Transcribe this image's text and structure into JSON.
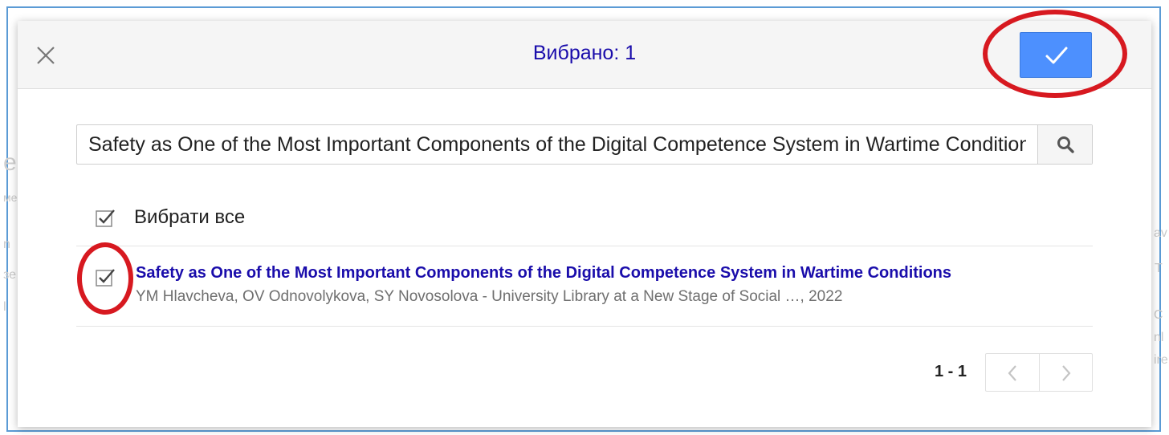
{
  "background_fragments": [
    "е",
    "ме",
    "n",
    "зе",
    "l",
    "av",
    "T",
    "С",
    "nl",
    "ire"
  ],
  "dialog": {
    "title": "Вибрано: 1",
    "close_icon": "close-icon",
    "confirm_icon": "checkmark-icon"
  },
  "search": {
    "value": "Safety as One of the Most Important Components of the Digital Competence System in Wartime Conditions",
    "icon": "search-icon"
  },
  "select_all": {
    "label": "Вибрати все",
    "checked": true
  },
  "results": [
    {
      "checked": true,
      "title": "Safety as One of the Most Important Components of the Digital Competence System in Wartime Conditions",
      "meta": "YM Hlavcheva, OV Odnovolykova, SY Novosolova - University Library at a New Stage of Social …, 2022"
    }
  ],
  "pagination": {
    "range": "1 - 1",
    "prev_icon": "chevron-left-icon",
    "next_icon": "chevron-right-icon"
  },
  "colors": {
    "accent": "#4d90fe",
    "title": "#1a0dab",
    "highlight_ring": "#d71920",
    "frame": "#5b9bd5"
  }
}
